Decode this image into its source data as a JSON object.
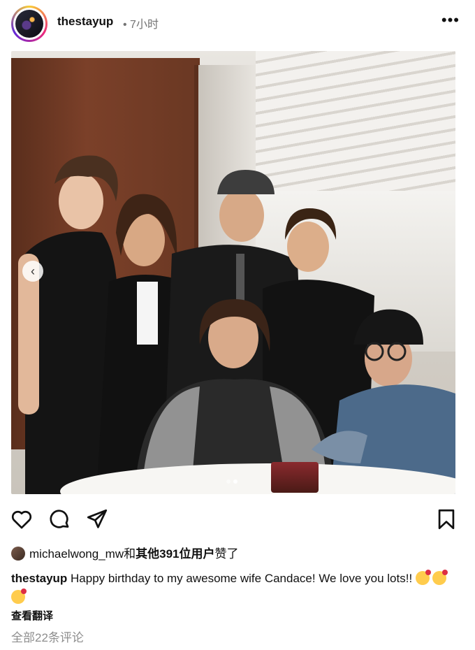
{
  "header": {
    "username": "thestayup",
    "time": "• 7小时",
    "more_label": "•••"
  },
  "post": {
    "carousel": {
      "slides": 2,
      "active_slide": 2
    }
  },
  "actions": {
    "like_icon": "heart-icon",
    "comment_icon": "comment-icon",
    "share_icon": "send-icon",
    "save_icon": "bookmark-icon"
  },
  "likes": {
    "user": "michaelwong_mw",
    "text_connector": "和",
    "others": "其他391位用户",
    "suffix": "赞了"
  },
  "caption": {
    "username": "thestayup",
    "text": "Happy birthday to my awesome wife Candace! We love you lots!!",
    "emoji": [
      "face-blowing-kiss",
      "face-blowing-kiss",
      "face-blowing-kiss"
    ]
  },
  "translate_label": "查看翻译",
  "comments_label": "全部22条评论",
  "colors": {
    "secondary_text": "#737373",
    "comments_text": "#8e8e8e"
  }
}
